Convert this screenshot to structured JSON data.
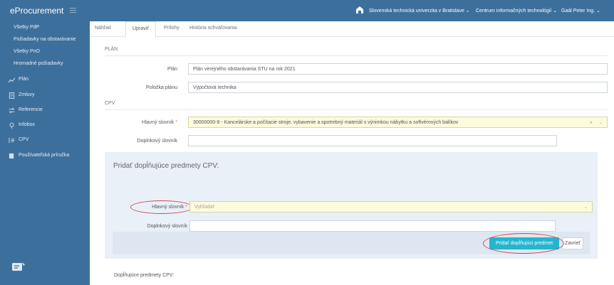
{
  "app": {
    "brand": "eProcurement",
    "university": "Slovenská technická univerzita v Bratislave ⌄",
    "department": "Centrum informačných technológií ⌄",
    "user": "Gaál Peter Ing. ⌄"
  },
  "sidebar": {
    "sub_items": [
      "Všetky PdP",
      "Požiadavky na obstarávanie",
      "Všetky PnO",
      "Hromadné požiadavky"
    ],
    "main_items": [
      {
        "label": "Plán",
        "icon": "line-chart-icon"
      },
      {
        "label": "Zmluvy",
        "icon": "document-icon"
      },
      {
        "label": "Referencie",
        "icon": "exchange-icon"
      },
      {
        "label": "Infobox",
        "icon": "info-pin-icon"
      },
      {
        "label": "CPV",
        "icon": "cpv-icon"
      },
      {
        "label": "Používateľská príručka",
        "icon": "book-icon"
      }
    ]
  },
  "tabs": [
    "Náhľad",
    "Upraviť",
    "Prílohy",
    "História schvaľovania"
  ],
  "active_tab": "Upraviť",
  "sections": {
    "plan_title": "PLÁN",
    "cpv_title": "CPV"
  },
  "form": {
    "plan_label": "Plán",
    "plan_value": "Plán verejného obstarávania STU na rok 2021",
    "item_label": "Položka plánu",
    "item_value": "Výpočtová technika",
    "main_dict_label": "Hlavný slovník",
    "main_dict_value": "30000000-9 - Kancelárske a počítacie stroje, vybavenie a spotrebný materiál s výnimkou nábytku a softvérových balíkov",
    "supp_dict_label": "Doplnkový slovník",
    "supp_dict_value": "",
    "required_mark": "*",
    "clear_glyph": "×",
    "caret_glyph": "⌄"
  },
  "panel": {
    "title": "Pridať dopĺňujúce predmety CPV:",
    "main_dict_label": "Hlavný slovník",
    "search_placeholder": "Vyhľadať",
    "supp_dict_label": "Doplnkový slovník",
    "add_button": "Pridať dopĺňujúci predmet",
    "close_button": "Zavrieť"
  },
  "bottom_label": "Dopĺňujúce predmety CPV:",
  "colors": {
    "brand_blue": "#3d6f9c",
    "accent_cyan": "#25b5cf",
    "highlight_red": "#cc4a52",
    "field_yellow": "#fcfbdc"
  }
}
